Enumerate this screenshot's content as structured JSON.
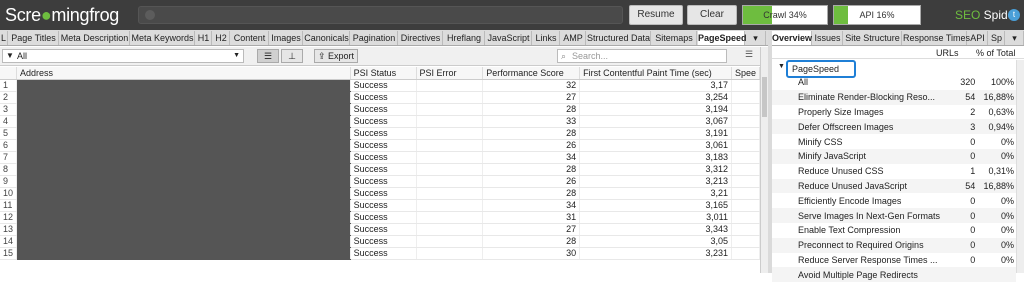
{
  "app": {
    "logo_prefix": "Scre",
    "logo_suffix": "mingfrog",
    "resume_label": "Resume",
    "clear_label": "Clear",
    "crawl_progress": {
      "label": "Crawl 34%",
      "fraction": 0.34
    },
    "api_progress": {
      "label": "API 16%",
      "fraction": 0.16
    },
    "product_seo": "SEO",
    "product_spider": " Spider"
  },
  "tabs": [
    {
      "label": "L"
    },
    {
      "label": "Page Titles"
    },
    {
      "label": "Meta Description"
    },
    {
      "label": "Meta Keywords"
    },
    {
      "label": "H1"
    },
    {
      "label": "H2"
    },
    {
      "label": "Content"
    },
    {
      "label": "Images"
    },
    {
      "label": "Canonicals"
    },
    {
      "label": "Pagination"
    },
    {
      "label": "Directives"
    },
    {
      "label": "Hreflang"
    },
    {
      "label": "JavaScript"
    },
    {
      "label": "Links"
    },
    {
      "label": "AMP"
    },
    {
      "label": "Structured Data"
    },
    {
      "label": "Sitemaps"
    },
    {
      "label": "PageSpeed"
    },
    {
      "label": "▾"
    }
  ],
  "right_tabs": [
    {
      "label": "Overview"
    },
    {
      "label": "Issues"
    },
    {
      "label": "Site Structure"
    },
    {
      "label": "Response Times"
    },
    {
      "label": "API"
    },
    {
      "label": "Sp"
    }
  ],
  "filter": {
    "selected": "All",
    "export_label": "Export",
    "search_placeholder": "Search..."
  },
  "grid": {
    "columns": [
      "Address",
      "PSI Status",
      "PSI Error",
      "Performance Score",
      "First Contentful Paint Time (sec)",
      "Spee"
    ],
    "rows": [
      {
        "n": "1",
        "status": "Success",
        "score": "32",
        "fcp": "3,17"
      },
      {
        "n": "2",
        "status": "Success",
        "score": "27",
        "fcp": "3,254"
      },
      {
        "n": "3",
        "status": "Success",
        "score": "28",
        "fcp": "3,194"
      },
      {
        "n": "4",
        "status": "Success",
        "score": "33",
        "fcp": "3,067"
      },
      {
        "n": "5",
        "status": "Success",
        "score": "28",
        "fcp": "3,191"
      },
      {
        "n": "6",
        "status": "Success",
        "score": "26",
        "fcp": "3,061"
      },
      {
        "n": "7",
        "status": "Success",
        "score": "34",
        "fcp": "3,183"
      },
      {
        "n": "8",
        "status": "Success",
        "score": "28",
        "fcp": "3,312"
      },
      {
        "n": "9",
        "status": "Success",
        "score": "26",
        "fcp": "3,213"
      },
      {
        "n": "10",
        "status": "Success",
        "score": "28",
        "fcp": "3,21"
      },
      {
        "n": "11",
        "status": "Success",
        "score": "34",
        "fcp": "3,165"
      },
      {
        "n": "12",
        "status": "Success",
        "score": "31",
        "fcp": "3,011"
      },
      {
        "n": "13",
        "status": "Success",
        "score": "27",
        "fcp": "3,343"
      },
      {
        "n": "14",
        "status": "Success",
        "score": "28",
        "fcp": "3,05"
      },
      {
        "n": "15",
        "status": "Success",
        "score": "30",
        "fcp": "3,231"
      }
    ]
  },
  "overview": {
    "col_urls": "URLs",
    "col_pct": "% of Total",
    "section": "PageSpeed",
    "rows": [
      {
        "label": "All",
        "urls": "320",
        "pct": "100%"
      },
      {
        "label": "Eliminate Render-Blocking Reso...",
        "urls": "54",
        "pct": "16,88%"
      },
      {
        "label": "Properly Size Images",
        "urls": "2",
        "pct": "0,63%"
      },
      {
        "label": "Defer Offscreen Images",
        "urls": "3",
        "pct": "0,94%"
      },
      {
        "label": "Minify CSS",
        "urls": "0",
        "pct": "0%"
      },
      {
        "label": "Minify JavaScript",
        "urls": "0",
        "pct": "0%"
      },
      {
        "label": "Reduce Unused CSS",
        "urls": "1",
        "pct": "0,31%"
      },
      {
        "label": "Reduce Unused JavaScript",
        "urls": "54",
        "pct": "16,88%"
      },
      {
        "label": "Efficiently Encode Images",
        "urls": "0",
        "pct": "0%"
      },
      {
        "label": "Serve Images In Next-Gen Formats",
        "urls": "0",
        "pct": "0%"
      },
      {
        "label": "Enable Text Compression",
        "urls": "0",
        "pct": "0%"
      },
      {
        "label": "Preconnect to Required Origins",
        "urls": "0",
        "pct": "0%"
      },
      {
        "label": "Reduce Server Response Times ...",
        "urls": "0",
        "pct": "0%"
      },
      {
        "label": "Avoid Multiple Page Redirects",
        "urls": "",
        "pct": ""
      }
    ]
  }
}
